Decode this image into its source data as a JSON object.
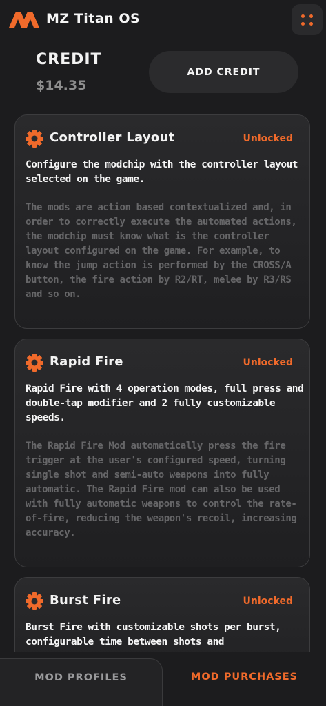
{
  "app": {
    "title": "MZ Titan OS",
    "accent": "#f06a2b"
  },
  "credit": {
    "label": "CREDIT",
    "value": "$14.35",
    "add_button": "ADD CREDIT"
  },
  "mods": [
    {
      "title": "Controller Layout",
      "status": "Unlocked",
      "summary": "Configure the modchip with the controller layout selected on the game.",
      "description": "The mods are action based contextualized and, in order to correctly execute the automated actions, the modchip must know what is the controller layout configured on the game. For example, to know the jump action is performed by the CROSS/A button, the fire action by R2/RT, melee by R3/RS and so on."
    },
    {
      "title": "Rapid Fire",
      "status": "Unlocked",
      "summary": "Rapid Fire with 4 operation modes, full press and double-tap modifier and 2 fully customizable speeds.",
      "description": "The Rapid Fire Mod automatically press the fire trigger at the user's configured speed, turning single shot and semi-auto weapons into fully automatic. The Rapid Fire mod can also be used with fully automatic weapons to control the rate-of-fire, reducing the weapon's recoil, increasing accuracy."
    },
    {
      "title": "Burst Fire",
      "status": "Unlocked",
      "summary": "Burst Fire with customizable shots per burst, configurable time between shots and"
    }
  ],
  "tabs": {
    "left": "MOD PROFILES",
    "right": "MOD PURCHASES"
  }
}
